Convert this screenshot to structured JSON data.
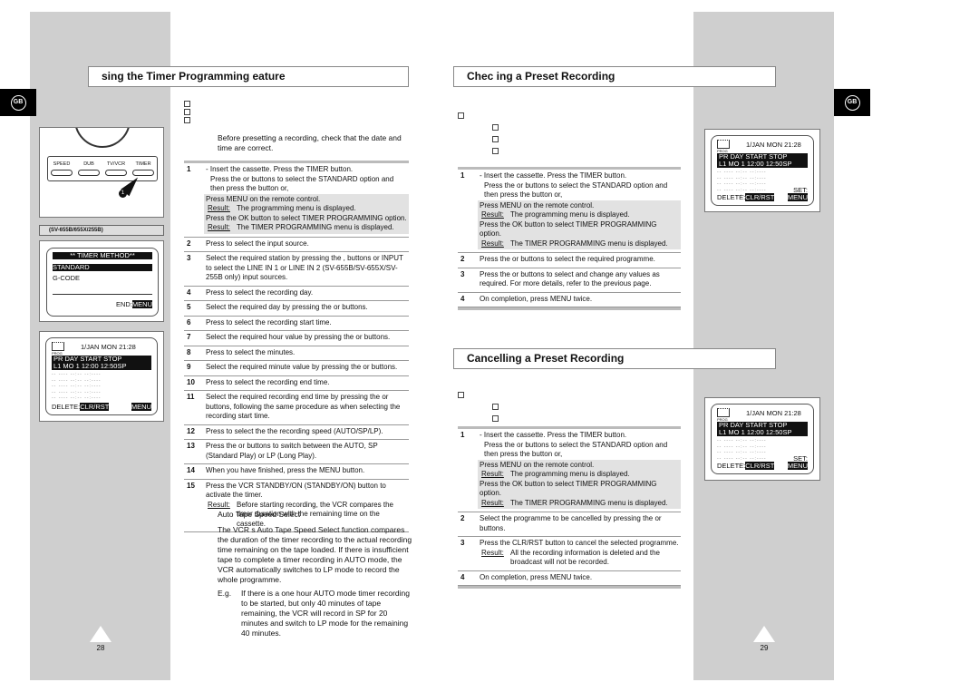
{
  "language_tab": "GB",
  "left_page": {
    "title": "sing the Timer Programming   eature",
    "intro_note": "Before presetting a recording, check that the date and time are correct.",
    "steps": [
      {
        "num": "1",
        "text": [
          "- Insert the cassette. Press the TIMER button.",
          "Press the    or    buttons to select the STANDARD option and then press the    button or,"
        ],
        "shaded": [
          "Press MENU on the remote control."
        ],
        "results": [
          {
            "label": "Result:",
            "text": "The programming menu is displayed."
          },
          {
            "pre": "Press the OK button to select TIMER PROGRAMMING option."
          },
          {
            "label": "Result:",
            "text": "The TIMER PROGRAMMING menu is displayed."
          }
        ]
      },
      {
        "num": "2",
        "text": [
          "Press    to select the input source."
        ]
      },
      {
        "num": "3",
        "text": [
          "Select the required station by pressing the    ,    buttons or INPUT to select the  LINE IN 1 or LINE IN 2  (SV-655B/SV-655X/SV-255B only) input sources."
        ]
      },
      {
        "num": "4",
        "text": [
          "Press    to select the recording day."
        ]
      },
      {
        "num": "5",
        "text": [
          "Select the required day by pressing the    or    buttons."
        ]
      },
      {
        "num": "6",
        "text": [
          "Press    to select the recording start time."
        ]
      },
      {
        "num": "7",
        "text": [
          "Select the required hour value by pressing the    or    buttons."
        ]
      },
      {
        "num": "8",
        "text": [
          "Press    to select the minutes."
        ]
      },
      {
        "num": "9",
        "text": [
          "Select the required minute value by pressing the    or    buttons."
        ]
      },
      {
        "num": "10",
        "text": [
          "Press    to select the recording end time."
        ]
      },
      {
        "num": "11",
        "text": [
          "Select the required recording end time by pressing the    or    buttons, following the same procedure as when selecting the recording start time."
        ]
      },
      {
        "num": "12",
        "text": [
          "Press    to select the the recording speed (AUTO/SP/LP)."
        ]
      },
      {
        "num": "13",
        "text": [
          "Press the    or    buttons to switch between the AUTO, SP (Standard Play) or LP (Long Play)."
        ]
      },
      {
        "num": "14",
        "text": [
          "When you have finished, press the MENU button."
        ]
      },
      {
        "num": "15",
        "text": [
          "Press the VCR STANDBY/ON (STANDBY/ON) button to activate the timer."
        ],
        "results": [
          {
            "label": "Result:",
            "text": "Before starting recording, the VCR compares the timer duration with the remaining time on the cassette."
          }
        ]
      }
    ],
    "tip": {
      "heading": "Auto Tape Speed Select",
      "body": "The VCR s  Auto Tape Speed Select  function compares the duration of the timer recording to the actual recording time remaining on the tape loaded. If there is insufficient tape to complete a timer recording in AUTO mode, the VCR automatically switches to LP mode to record the whole programme.",
      "eg_label": "E.g.",
      "eg_text": "If there is a one hour AUTO mode timer recording to be started, but only 40 minutes of tape remaining, the VCR will record in SP for 20 minutes and switch to LP mode for the remaining 40 minutes."
    },
    "page_number": "28",
    "remote_buttons": [
      "SPEED",
      "DUB",
      "TV/VCR",
      "TIMER"
    ],
    "callout": "1",
    "model_label": "(SV-655B/655X/255B)",
    "timer_method": {
      "title": "**  TIMER METHOD**",
      "options": [
        "STANDARD",
        "G-CODE"
      ],
      "end_label": "END:",
      "end_key": "MENU"
    }
  },
  "timer_screen": {
    "prog_label": "PROG",
    "date": "1/JAN MON   21:28",
    "header": "PR DAY  START   STOP",
    "row": "L1 MO  1  12:00    12:50SP",
    "empty_row": "-- ---- --:--            --:----",
    "delete_label": "DELETE:",
    "delete_key": "CLR/RST",
    "menu_key": "MENU",
    "set_label": "SET:"
  },
  "right_page": {
    "check_title": "Chec  ing a Preset Recording",
    "check_steps": [
      {
        "num": "1",
        "text": [
          "- Insert the cassette. Press the TIMER button.",
          "Press the    or    buttons to select the STANDARD option and then press the    button or,"
        ],
        "shaded": [
          "Press MENU on the remote control."
        ],
        "results": [
          {
            "label": "Result:",
            "text": "The programming menu is displayed."
          },
          {
            "pre": "Press the OK button to select TIMER PROGRAMMING option."
          },
          {
            "label": "Result:",
            "text": "The TIMER PROGRAMMING menu is displayed."
          }
        ]
      },
      {
        "num": "2",
        "text": [
          "Press the    or    buttons to select the required programme."
        ]
      },
      {
        "num": "3",
        "text": [
          "Press the    or    buttons to select and change any values as required. For more details, refer to the previous page."
        ]
      },
      {
        "num": "4",
        "text": [
          "On completion, press MENU twice."
        ]
      }
    ],
    "cancel_title": "Cancelling a Preset Recording",
    "cancel_steps": [
      {
        "num": "1",
        "text": [
          "- Insert the cassette. Press the TIMER button.",
          "Press the    or    buttons to select the STANDARD option and then press the    button or,"
        ],
        "shaded": [
          "Press MENU on the remote control."
        ],
        "results": [
          {
            "label": "Result:",
            "text": "The programming menu is displayed."
          },
          {
            "pre": "Press the OK button to select TIMER PROGRAMMING option."
          },
          {
            "label": "Result:",
            "text": "The TIMER PROGRAMMING menu is displayed."
          }
        ]
      },
      {
        "num": "2",
        "text": [
          "Select the programme to be cancelled by pressing the    or    buttons."
        ]
      },
      {
        "num": "3",
        "text": [
          "Press the CLR/RST button to cancel the selected programme."
        ],
        "results": [
          {
            "label": "Result:",
            "text": "All the recording information is deleted and the broadcast will not be recorded."
          }
        ]
      },
      {
        "num": "4",
        "text": [
          "On completion, press MENU twice."
        ]
      }
    ],
    "page_number": "29"
  }
}
